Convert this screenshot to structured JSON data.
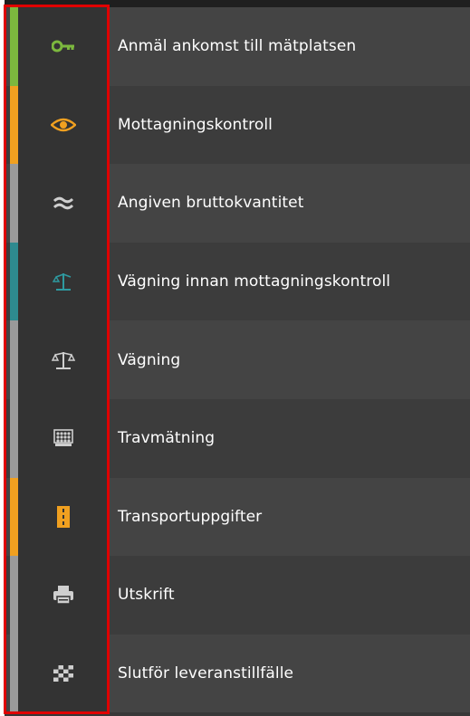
{
  "menu": {
    "items": [
      {
        "label": "Anmäl ankomst till mätplatsen",
        "icon": "key-icon",
        "accent": "#7cb83e",
        "icon_color": "#7cb83e"
      },
      {
        "label": "Mottagningskontroll",
        "icon": "eye-icon",
        "accent": "#f0a020",
        "icon_color": "#f0a020"
      },
      {
        "label": "Angiven bruttokvantitet",
        "icon": "approx-icon",
        "accent": "#9a9a9a",
        "icon_color": "#cfcfcf"
      },
      {
        "label": "Vägning innan mottagningskontroll",
        "icon": "scale-pre-icon",
        "accent": "#2e8a8f",
        "icon_color": "#2e9aa0"
      },
      {
        "label": "Vägning",
        "icon": "scale-icon",
        "accent": "#9a9a9a",
        "icon_color": "#cfcfcf"
      },
      {
        "label": "Travmätning",
        "icon": "stack-measure-icon",
        "accent": "#9a9a9a",
        "icon_color": "#cfcfcf"
      },
      {
        "label": "Transportuppgifter",
        "icon": "road-icon",
        "accent": "#f0a020",
        "icon_color": "#f0a020"
      },
      {
        "label": "Utskrift",
        "icon": "printer-icon",
        "accent": "#9a9a9a",
        "icon_color": "#cfcfcf"
      },
      {
        "label": "Slutför leveranstillfälle",
        "icon": "checkered-flag-icon",
        "accent": "#9a9a9a",
        "icon_color": "#cfcfcf"
      }
    ]
  },
  "highlight_color": "#e00000"
}
